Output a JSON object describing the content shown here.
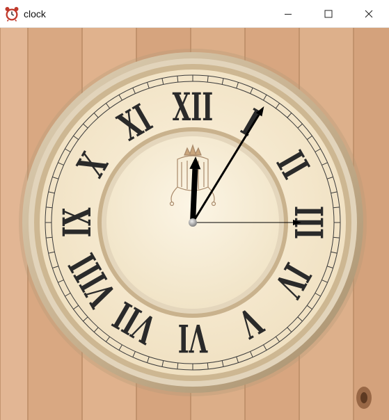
{
  "window": {
    "title": "clock",
    "app_icon": "alarm-clock-icon",
    "controls": {
      "minimize": "minimize-icon",
      "maximize": "maximize-icon",
      "close": "close-icon"
    }
  },
  "clock": {
    "numerals": [
      "XII",
      "I",
      "II",
      "III",
      "IV",
      "V",
      "VI",
      "VII",
      "VIII",
      "IX",
      "X",
      "XI"
    ],
    "time": {
      "hour": 12,
      "minute": 5,
      "second": 15
    },
    "colors": {
      "wood": "#d9a882",
      "face": "#f1e3c4",
      "rim": "#c7b08e",
      "numeral": "#2a2a2a",
      "hand": "#000000"
    }
  }
}
